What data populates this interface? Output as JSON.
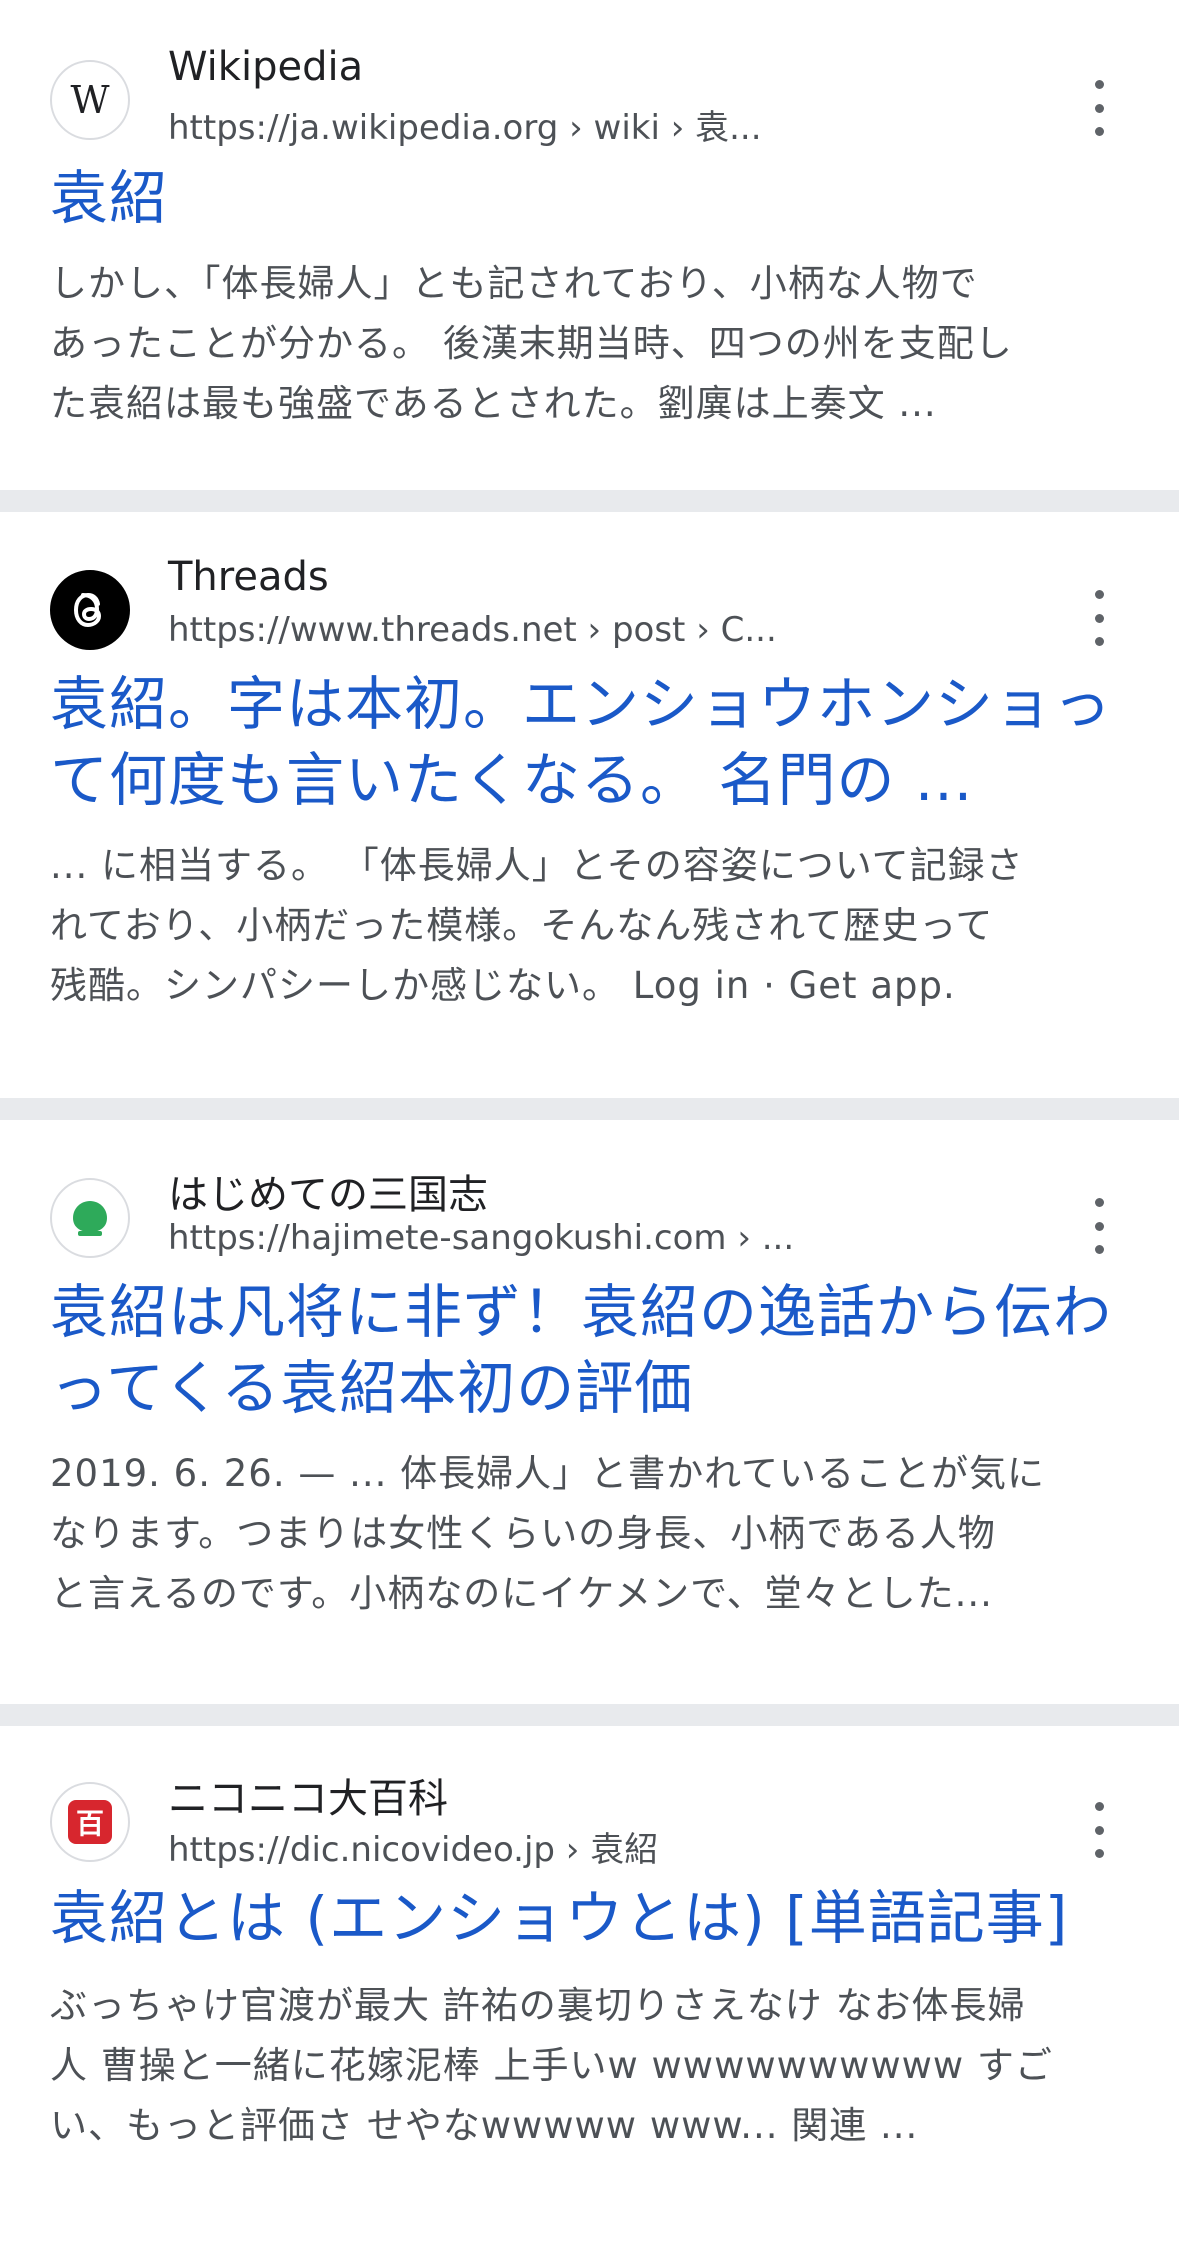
{
  "results": [
    {
      "site_name": "Wikipedia",
      "url_base": "https://ja.wikipedia.org",
      "url_path": " › wiki › 袁...",
      "favicon_icon": "wikipedia-icon",
      "favicon_text": "W",
      "title": "袁紹",
      "snippet_lines": [
        "しかし、「体長婦人」とも記されており、小柄な人物で",
        "あったことが分かる。 後漢末期当時、四つの州を支配し",
        "た袁紹は最も強盛であるとされた。劉廙は上奏文 ..."
      ]
    },
    {
      "site_name": "Threads",
      "url_base": "https://www.threads.net",
      "url_path": " › post › C...",
      "favicon_icon": "threads-icon",
      "favicon_text": "@",
      "title_lines": [
        "袁紹。字は本初。エンショウホンショっ",
        "て何度も言いたくなる。 名門の ..."
      ],
      "snippet_lines": [
        "... に相当する。 「体長婦人」とその容姿について記録さ",
        "れており、小柄だった模様。そんなん残されて歴史って",
        "残酷。シンパシーしか感じない。 Log in · Get app."
      ]
    },
    {
      "site_name": "はじめての三国志",
      "url_base": "https://hajimete-sangokushi.com",
      "url_path": " › ...",
      "favicon_icon": "peach-icon",
      "title_lines": [
        "袁紹は凡将に非ず！袁紹の逸話から伝わ",
        "ってくる袁紹本初の評価"
      ],
      "snippet_lines": [
        "2019. 6. 26. — ... 体長婦人」と書かれていることが気に",
        "なります。つまりは女性くらいの身長、小柄である人物",
        "と言えるのです。小柄なのにイケメンで、堂々とした..."
      ]
    },
    {
      "site_name": "ニコニコ大百科",
      "url_base": "https://dic.nicovideo.jp",
      "url_path": " › 袁紹",
      "favicon_icon": "nicovideo-icon",
      "favicon_text": "百",
      "title": "袁紹とは (エンショウとは) [単語記事]",
      "snippet_lines": [
        "ぶっちゃけ官渡が最大 許祐の裏切りさえなけ なお体長婦",
        "人 曹操と一緒に花嫁泥棒 上手いw wwwwwwwwww すご",
        "い、もっと評価さ せやなwwwww www... 関連 ..."
      ]
    }
  ],
  "colors": {
    "title_link": "#1a59c8",
    "snippet_text": "#4d5156",
    "separator": "#e8eaed"
  }
}
